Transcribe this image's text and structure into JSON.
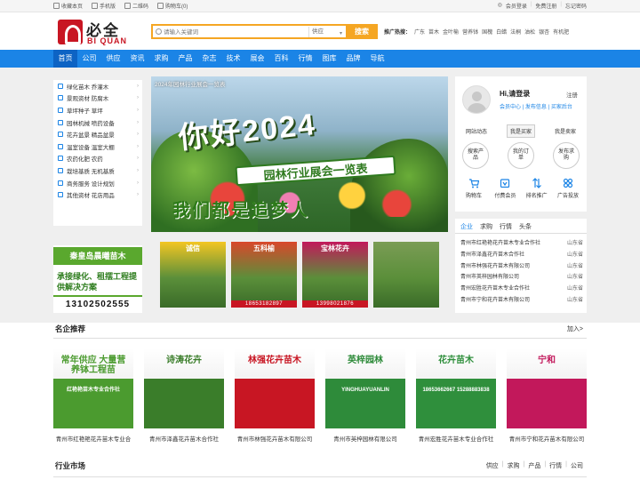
{
  "topbar": {
    "left": [
      "收藏本页",
      "手机版",
      "二维码",
      "购物车(0)"
    ],
    "right": [
      "会员登录",
      "免费注册",
      "忘记密码"
    ]
  },
  "logo": {
    "cn": "必全",
    "en": "BI QUAN"
  },
  "search": {
    "placeholder": "请输入关键词",
    "category": "供应",
    "button": "搜索"
  },
  "hot": {
    "label": "推广热搜：",
    "items": [
      "广东",
      "苗木",
      "金叶榆",
      "营养钵",
      "国槐",
      "白蜡",
      "法桐",
      "油松",
      "银杏",
      "有机肥"
    ]
  },
  "nav": [
    "首页",
    "公司",
    "供应",
    "资讯",
    "求购",
    "产品",
    "杂志",
    "技术",
    "展会",
    "百科",
    "行情",
    "图库",
    "品牌",
    "导航"
  ],
  "categories": [
    "绿化苗木 乔灌木",
    "景观资材 防腐木",
    "草坪种子 草坪",
    "园林机械 喷药设备",
    "花卉盆景 精品盆景",
    "温室设备 温室大棚",
    "农药化肥 农药",
    "栽培基质 无机基质",
    "商务服务 设计规划",
    "其他资材 花店用品"
  ],
  "left_ad": {
    "title": "秦皇岛晨曦苗木",
    "slogan": "承接绿化、租摆工程提供解决方案",
    "phone": "13102502555"
  },
  "banner": {
    "caption": "2024年园林行业展会一览表",
    "headline": "你好2024",
    "ribbon": "园林行业展会一览表",
    "slogan": "我们都是追梦人"
  },
  "thumbs": [
    {
      "title": "诚信",
      "phone": "",
      "color": "#f3c623"
    },
    {
      "title": "五科榆",
      "phone": "18653182897",
      "color": "#d9472b"
    },
    {
      "title": "宝林花卉",
      "phone": "13998021876",
      "color": "#c2185b"
    },
    {
      "title": "",
      "phone": "",
      "color": "#7a9c55"
    }
  ],
  "user": {
    "greeting": "Hi,请登录",
    "register": "注册",
    "links": [
      "会员中心",
      "发布信息",
      "买家后台"
    ],
    "tabs": [
      "网站动态",
      "我是买家",
      "我是卖家"
    ],
    "circles": [
      "搜索产品",
      "我的订单",
      "发布求购"
    ],
    "tools": [
      {
        "label": "购物车",
        "icon": "cart-icon"
      },
      {
        "label": "付费会员",
        "icon": "vip-icon"
      },
      {
        "label": "排名推广",
        "icon": "rank-icon"
      },
      {
        "label": "广告投放",
        "icon": "ad-icon"
      }
    ]
  },
  "list": {
    "tabs": [
      "企业",
      "求购",
      "行情",
      "头条"
    ],
    "items": [
      {
        "name": "青州市红艳艳花卉苗木专业合作社",
        "place": "山东省"
      },
      {
        "name": "青州市泽鑫花卉苗木合作社",
        "place": "山东省"
      },
      {
        "name": "青州市林强花卉苗木有限公司",
        "place": "山东省"
      },
      {
        "name": "青州市英梓园林有限公司",
        "place": "山东省"
      },
      {
        "name": "青州宏胜花卉苗木专业合作社",
        "place": "山东省"
      },
      {
        "name": "青州市宁和花卉苗木有限公司",
        "place": "山东省"
      }
    ]
  },
  "famous": {
    "title": "名企推荐",
    "more": "加入>",
    "cards": [
      {
        "name": "青州市红艳艳花卉苗木专业合",
        "poster": "常年供应 大量营养钵工程苗",
        "sub": "红艳艳苗木专业合作社",
        "color": "#4b9b2f"
      },
      {
        "name": "青州市泽鑫花卉苗木合作社",
        "poster": "诗涛花卉",
        "sub": "",
        "color": "#3a7d2a"
      },
      {
        "name": "青州市林强花卉苗木有限公司",
        "poster": "林强花卉苗木",
        "sub": "",
        "color": "#c81623"
      },
      {
        "name": "青州市英梓园林有限公司",
        "poster": "英梓园林",
        "sub": "YINGHUAYUANLIN",
        "color": "#2e8b3a"
      },
      {
        "name": "青州宏胜花卉苗木专业合作社",
        "poster": "花卉苗木",
        "sub": "18653662667 15288883838",
        "color": "#2f8f3c"
      },
      {
        "name": "青州市宁和花卉苗木有限公司",
        "poster": "宁和",
        "sub": "",
        "color": "#c2185b"
      }
    ]
  },
  "market": {
    "title": "行业市场",
    "links": [
      "供应",
      "求购",
      "产品",
      "行情",
      "公司"
    ]
  }
}
